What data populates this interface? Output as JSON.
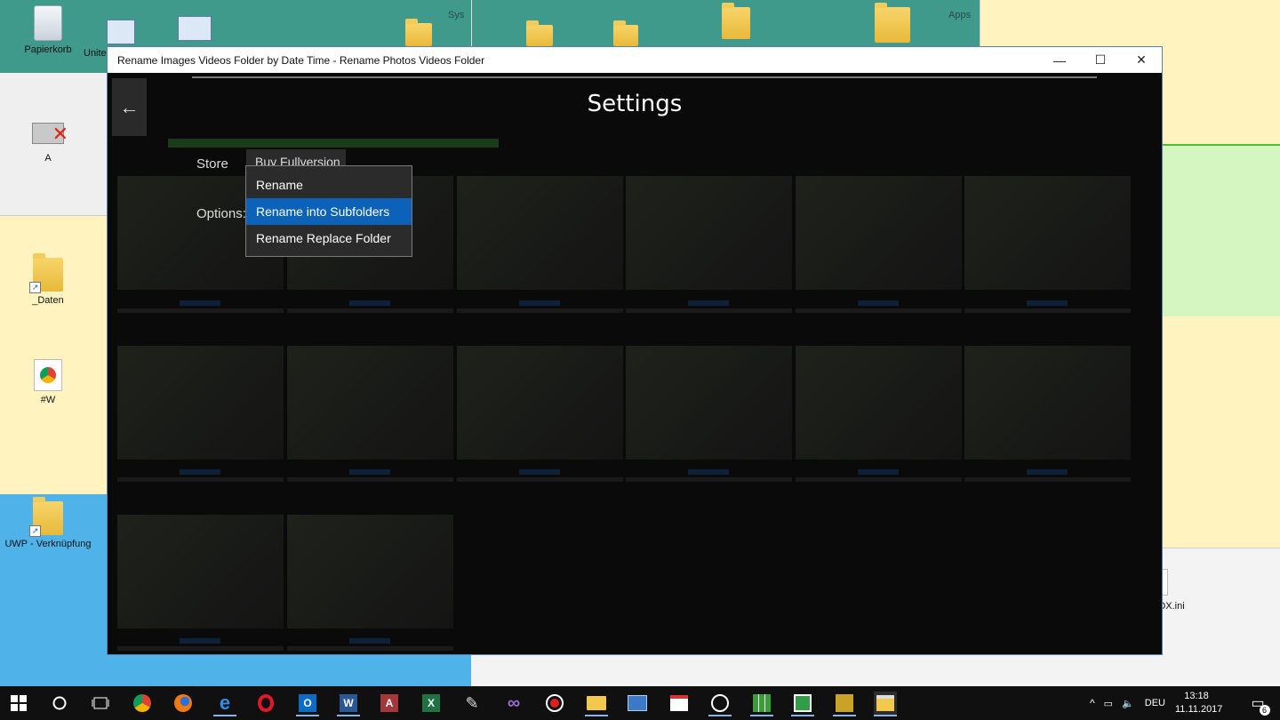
{
  "desktop": {
    "zones": [
      {
        "name": "Sys",
        "color": "#3f9a8c"
      },
      {
        "name": "Apps",
        "color": "#3f9a8c"
      }
    ],
    "icons": [
      {
        "label": "Papierkorb"
      },
      {
        "label": "Unite"
      },
      {
        "label": "A"
      },
      {
        "label": "_Daten"
      },
      {
        "label": "#W"
      },
      {
        "label": "UWP - Verknüpfung"
      },
      {
        "label": "DX.ini"
      }
    ]
  },
  "window": {
    "title": "Rename Images Videos Folder by Date Time - Rename Photos Videos Folder",
    "controls": {
      "minimize": "—",
      "maximize": "☐",
      "close": "✕"
    }
  },
  "settings": {
    "back_icon": "←",
    "title": "Settings",
    "store_label": "Store",
    "buy_button": "Buy Fullversion",
    "options_label": "Options:"
  },
  "dropdown": {
    "options": [
      "Rename",
      "Rename into Subfolders",
      "Rename Replace Folder"
    ],
    "selected": "Rename into Subfolders"
  },
  "taskbar": {
    "apps": [
      "start",
      "cortana",
      "task-view",
      "chrome",
      "firefox",
      "edge",
      "opera",
      "outlook",
      "word",
      "access",
      "excel",
      "pen",
      "visual-studio",
      "record",
      "explorer",
      "network",
      "calendar",
      "whatsapp",
      "grid-app",
      "image-app",
      "media-app",
      "settings-app"
    ],
    "language": "DEU",
    "time": "13:18",
    "date": "11.11.2017",
    "notifications": "6"
  },
  "colors": {
    "accent": "#0b62b8",
    "desktop_teal": "#3f9a8c",
    "desktop_yellow": "#fff4bf",
    "desktop_blue": "#4fb3ea",
    "desktop_green": "#d5f6c0"
  }
}
